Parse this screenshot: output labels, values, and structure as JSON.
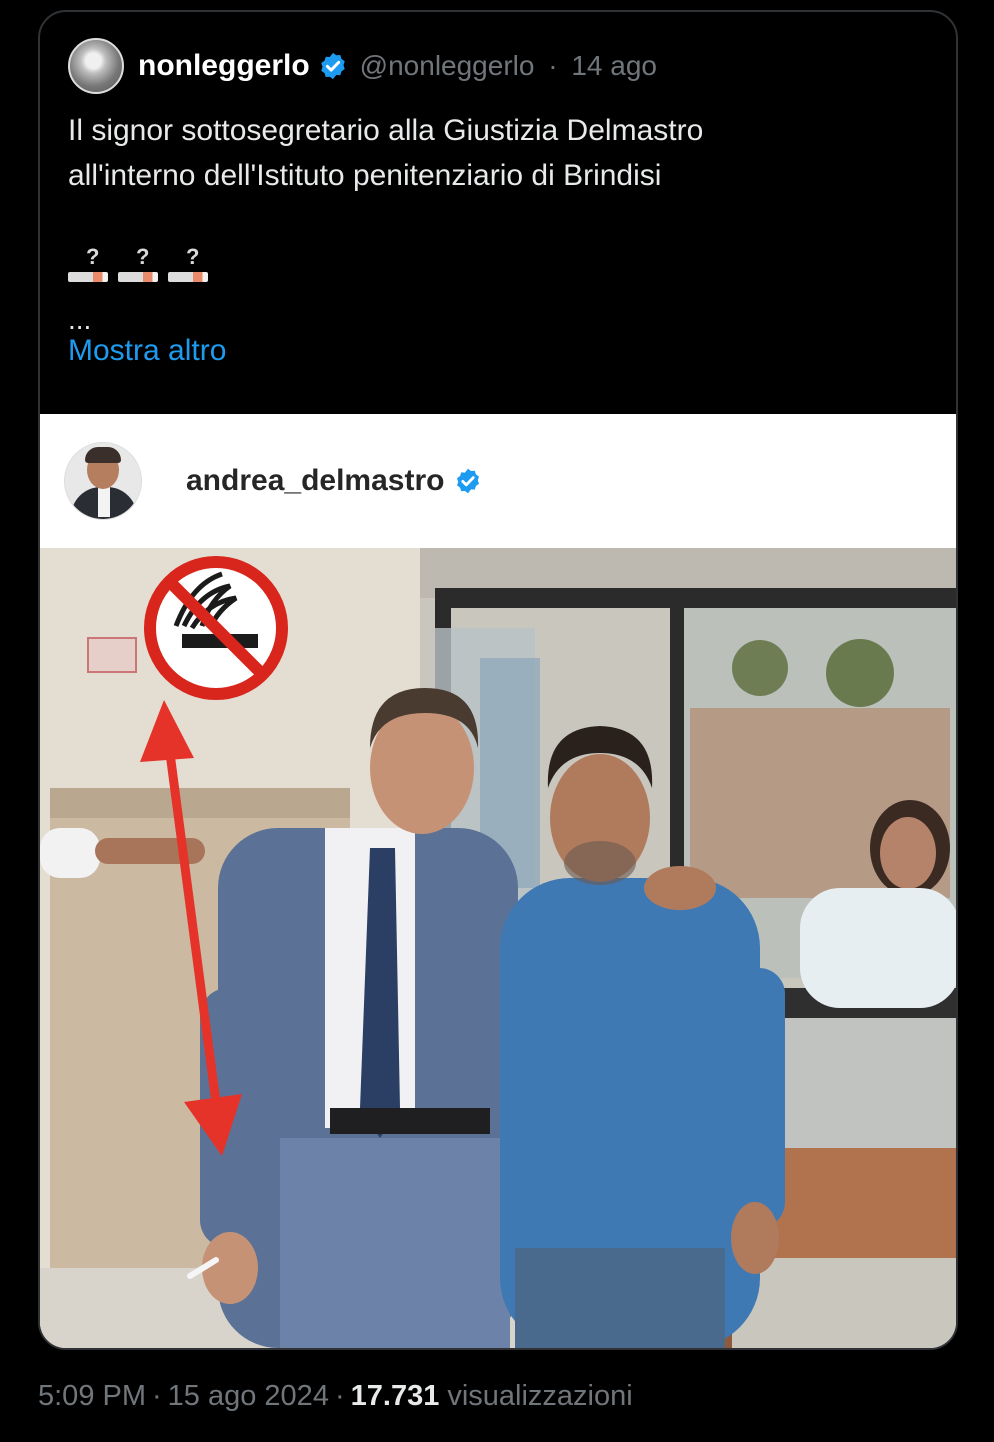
{
  "quote_tweet": {
    "display_name": "nonleggerlo",
    "handle": "@nonleggerlo",
    "separator": "·",
    "date": "14 ago",
    "text_line1": "Il signor sottosegretario alla Giustizia Delmastro",
    "text_line2": "all'interno dell'Istituto penitenziario di Brindisi",
    "emoji_glyphs": [
      "?",
      "?",
      "?"
    ],
    "ellipsis": "...",
    "show_more": "Mostra altro"
  },
  "embedded_post": {
    "username": "andrea_delmastro"
  },
  "footer": {
    "time": "5:09 PM",
    "separator": "·",
    "date": "15 ago 2024",
    "separator2": "·",
    "views_count": "17.731",
    "views_label": "visualizzazioni"
  },
  "colors": {
    "accent": "#1d9bf0",
    "arrow": "#e63329",
    "no_smoking": "#d9261c"
  },
  "icons": [
    "verified-badge-icon",
    "no-smoking-icon",
    "cigarette-emoji-icon",
    "double-arrow-icon"
  ]
}
